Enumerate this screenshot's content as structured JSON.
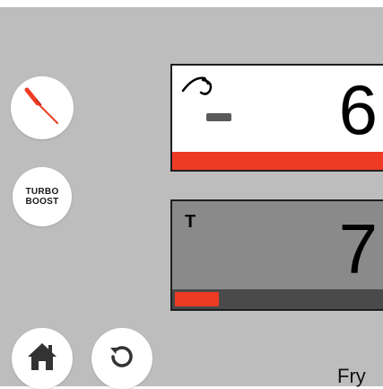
{
  "left_controls": {
    "probe_icon": "probe-icon",
    "turbo_line1": "TURBO",
    "turbo_line2": "BOOST"
  },
  "top_panel": {
    "icon": "basket-hook-icon",
    "dash": "-",
    "value": "6",
    "progress_fraction": 1.0
  },
  "bottom_panel": {
    "label": "T",
    "value": "7",
    "progress_fraction": 0.21
  },
  "bottom_controls": {
    "home_icon": "home-icon",
    "reset_icon": "refresh-icon",
    "mode_label": "Fry"
  },
  "colors": {
    "accent": "#ee3b24",
    "background": "#bdbdbd",
    "button": "#ffffff",
    "track": "#4a4a4a",
    "inactive_panel": "#8a8a8a"
  }
}
